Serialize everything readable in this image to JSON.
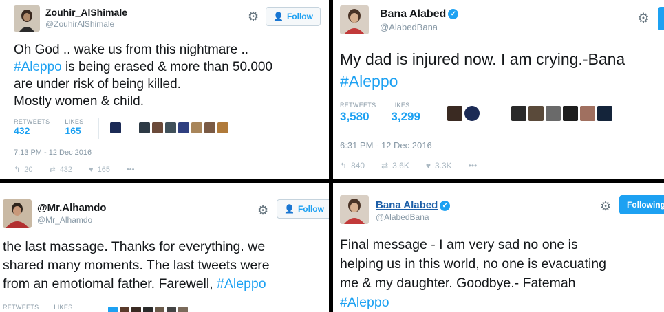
{
  "tweets": [
    {
      "name": "Zouhir_AlShimale",
      "handle": "@ZouhirAlShimale",
      "verified": false,
      "follow_label": "Follow",
      "text": "Oh God .. wake us from this nightmare ..",
      "text_hashtag": "#Aleppo",
      "text_rest": " is being erased & more than 50.000\nare under risk of being killed.\nMostly women & child.",
      "retweets_label": "RETWEETS",
      "retweets": "432",
      "likes_label": "LIKES",
      "likes": "165",
      "time": "7:13 PM - 12 Dec 2016",
      "reply_count": "20",
      "retweet_count": "432",
      "like_count": "165",
      "more": "•••"
    },
    {
      "name": "Bana Alabed",
      "handle": "@AlabedBana",
      "verified": true,
      "text": "My dad is injured now. I am crying.-Bana",
      "text_hashtag": "#Aleppo",
      "retweets_label": "RETWEETS",
      "retweets": "3,580",
      "likes_label": "LIKES",
      "likes": "3,299",
      "time": "6:31 PM - 12 Dec 2016",
      "reply_count": "840",
      "retweet_count": "3.6K",
      "like_count": "3.3K",
      "more": "•••"
    },
    {
      "name": "@Mr.Alhamdo",
      "handle": "@Mr_Alhamdo",
      "verified": false,
      "follow_label": "Follow",
      "text": "the last massage. Thanks for everything.  we\nshared many moments. The last tweets were\nfrom an emotiomal father. Farewell, ",
      "text_hashtag": "#Aleppo",
      "retweets_label": "RETWEETS",
      "likes_label": "LIKES"
    },
    {
      "name": "Bana Alabed",
      "handle": "@AlabedBana",
      "verified": true,
      "follow_label": "Following",
      "text": "Final message - I am very sad no one is\nhelping us in this world, no one is evacuating\nme & my daughter. Goodbye.- Fatemah",
      "text_hashtag": "#Aleppo"
    }
  ],
  "colors": {
    "link": "#1da1f2",
    "muted": "#8899a6",
    "text": "#14171a"
  }
}
